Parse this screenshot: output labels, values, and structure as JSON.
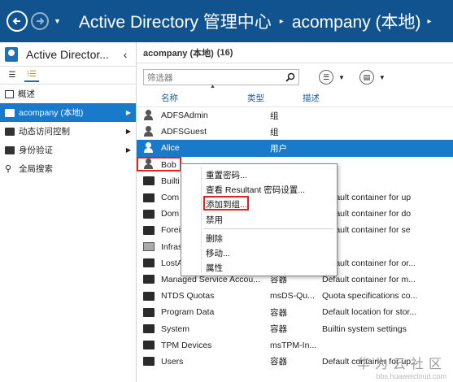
{
  "window": {
    "title_app": "Active Directory 管理中心",
    "title_node": "acompany (本地)"
  },
  "left_panel": {
    "header": "Active Director...",
    "items": [
      {
        "label": "概述",
        "icon": "overview-icon"
      },
      {
        "label": "acompany (本地)",
        "icon": "domain-icon",
        "active": true
      },
      {
        "label": "动态访问控制",
        "icon": "folder-icon"
      },
      {
        "label": "身份验证",
        "icon": "folder-icon"
      },
      {
        "label": "全局搜索",
        "icon": "search-icon"
      }
    ]
  },
  "main": {
    "header_name": "acompany (本地)",
    "header_count": "(16)",
    "filter_placeholder": "筛选器",
    "columns": {
      "name": "名称",
      "type": "类型",
      "desc": "描述"
    },
    "rows": [
      {
        "name": "ADFSAdmin",
        "type": "组",
        "desc": "",
        "icon": "group"
      },
      {
        "name": "ADFSGuest",
        "type": "组",
        "desc": "",
        "icon": "group"
      },
      {
        "name": "Alice",
        "type": "用户",
        "desc": "",
        "icon": "user",
        "selected": true
      },
      {
        "name": "Bob",
        "type": "",
        "desc": "",
        "icon": "user"
      },
      {
        "name": "Builti",
        "type": "",
        "desc": "",
        "icon": "folder"
      },
      {
        "name": "Com",
        "type": "",
        "desc": "Default container for up",
        "icon": "folder"
      },
      {
        "name": "Dom",
        "type": "",
        "desc": "Default container for do",
        "icon": "folder"
      },
      {
        "name": "Forei",
        "type": "",
        "desc": "Default container for se",
        "icon": "folder"
      },
      {
        "name": "Infras",
        "type": "",
        "desc": "",
        "icon": "box"
      },
      {
        "name": "LostAndFound",
        "type": "lostAndFo...",
        "desc": "Default container for or...",
        "icon": "folder"
      },
      {
        "name": "Managed Service Accou...",
        "type": "容器",
        "desc": "Default container for m...",
        "icon": "folder"
      },
      {
        "name": "NTDS Quotas",
        "type": "msDS-Qu...",
        "desc": "Quota specifications co...",
        "icon": "folder"
      },
      {
        "name": "Program Data",
        "type": "容器",
        "desc": "Default location for stor...",
        "icon": "folder"
      },
      {
        "name": "System",
        "type": "容器",
        "desc": "Builtin system settings",
        "icon": "folder"
      },
      {
        "name": "TPM Devices",
        "type": "msTPM-In...",
        "desc": "",
        "icon": "folder"
      },
      {
        "name": "Users",
        "type": "容器",
        "desc": "Default container for up...",
        "icon": "folder"
      }
    ]
  },
  "context_menu": {
    "items": [
      "重置密码...",
      "查看 Resultant 密码设置...",
      "添加到组...",
      "禁用",
      "删除",
      "移动...",
      "属性"
    ]
  },
  "watermark": {
    "line1": "华为云社区",
    "line2": "bbs.huaweicloud.com"
  }
}
